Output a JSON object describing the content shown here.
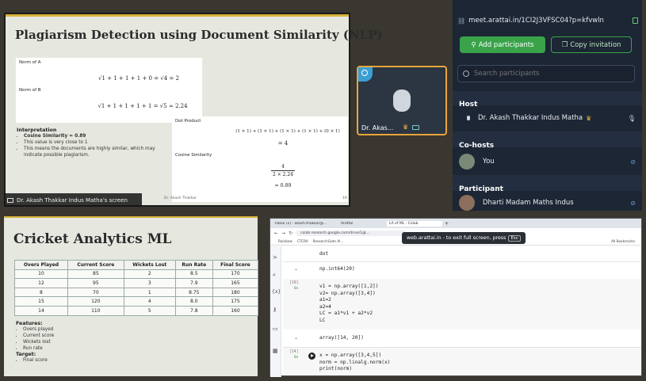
{
  "slide1": {
    "title": "Plagiarism Detection using Document Similarity (NLP)",
    "norm_a_label": "Norm of A",
    "norm_a_expr": "√1 + 1 + 1 + 1 + 0 = √4 = 2",
    "norm_b_label": "Norm of B",
    "norm_b_expr": "√1 + 1 + 1 + 1 + 1 = √5 ≈ 2.24",
    "dot_product_label": "Dot Product",
    "dot_product_expr": "(1 × 1) + (1 × 1) + (1 × 1) + (1 × 1) + (0 × 1)",
    "dot_product_result": "= 4",
    "cosine_label": "Cosine Similarity",
    "cosine_num": "4",
    "cosine_den": "2 × 2.24",
    "cosine_result": "≈ 0.89",
    "interp_heading": "Interpretation",
    "interp_items": [
      "Cosine Similarity ≈ 0.89",
      "This value is very close to 1",
      "This means the documents are highly similar, which may indicate possible plagiarism."
    ],
    "footer": "Dr. Akash Thakkar",
    "page_no": "19",
    "screen_share_label": "Dr. Akash Thakkar Indus Matha's screen"
  },
  "video_tile": {
    "name": "Dr. Akas..."
  },
  "sidebar": {
    "invite_url": "meet.arattai.in/1CI2J3VFSC04?p=kfvwln",
    "add_participants": "Add participants",
    "copy_invitation": "Copy invitation",
    "search_placeholder": "Search participants",
    "host_heading": "Host",
    "host_name": "Dr. Akash Thakkar Indus Matha",
    "cohosts_heading": "Co-hosts",
    "cohost_name": "You",
    "participant_heading": "Participant",
    "participant_name": "Dharti Madam Maths Indus"
  },
  "slide2": {
    "title": "Cricket Analytics ML",
    "columns": [
      "Overs Played",
      "Current Score",
      "Wickets Lost",
      "Run Rate",
      "Final Score"
    ],
    "rows": [
      [
        "10",
        "85",
        "2",
        "8.5",
        "170"
      ],
      [
        "12",
        "95",
        "3",
        "7.9",
        "165"
      ],
      [
        "8",
        "70",
        "1",
        "8.75",
        "180"
      ],
      [
        "15",
        "120",
        "4",
        "8.0",
        "175"
      ],
      [
        "14",
        "110",
        "5",
        "7.8",
        "160"
      ]
    ],
    "features_heading": "Features:",
    "features": [
      "Overs played",
      "Current score",
      "Wickets lost",
      "Run rate"
    ],
    "target_heading": "Target:",
    "target": [
      "Final score"
    ]
  },
  "browser": {
    "tabs": [
      "Inbox (2) - akash.thakkar@...",
      "Arattai",
      "LA of ML - Colab"
    ],
    "address": "colab.research.google.com/drive/1gL...",
    "bookmarks": [
      "Rainbow",
      "CTCRA",
      "ResearchGate AI..."
    ],
    "all_bookmarks": "All Bookmarks",
    "fullscreen_notice": "web.arattai.in - to exit full screen, press",
    "esc_key": "Esc",
    "cells": [
      {
        "lines": [
          "dot"
        ]
      },
      {
        "output": "np.int64(20)"
      },
      {
        "count": "[10]",
        "time": "0s",
        "lines": [
          "v1 = np.array([1,2])",
          "v2= np.array([3,4])",
          "a1=2",
          "a2=4",
          "LC = a1*v1 + a2*v2",
          "LC"
        ]
      },
      {
        "output": "array([14, 20])"
      },
      {
        "count": "[14]",
        "time": "0s",
        "lines": [
          "x = np.array([3,4,5])",
          "norm = np.linalg.norm(x)",
          "print(norm)"
        ]
      }
    ]
  }
}
